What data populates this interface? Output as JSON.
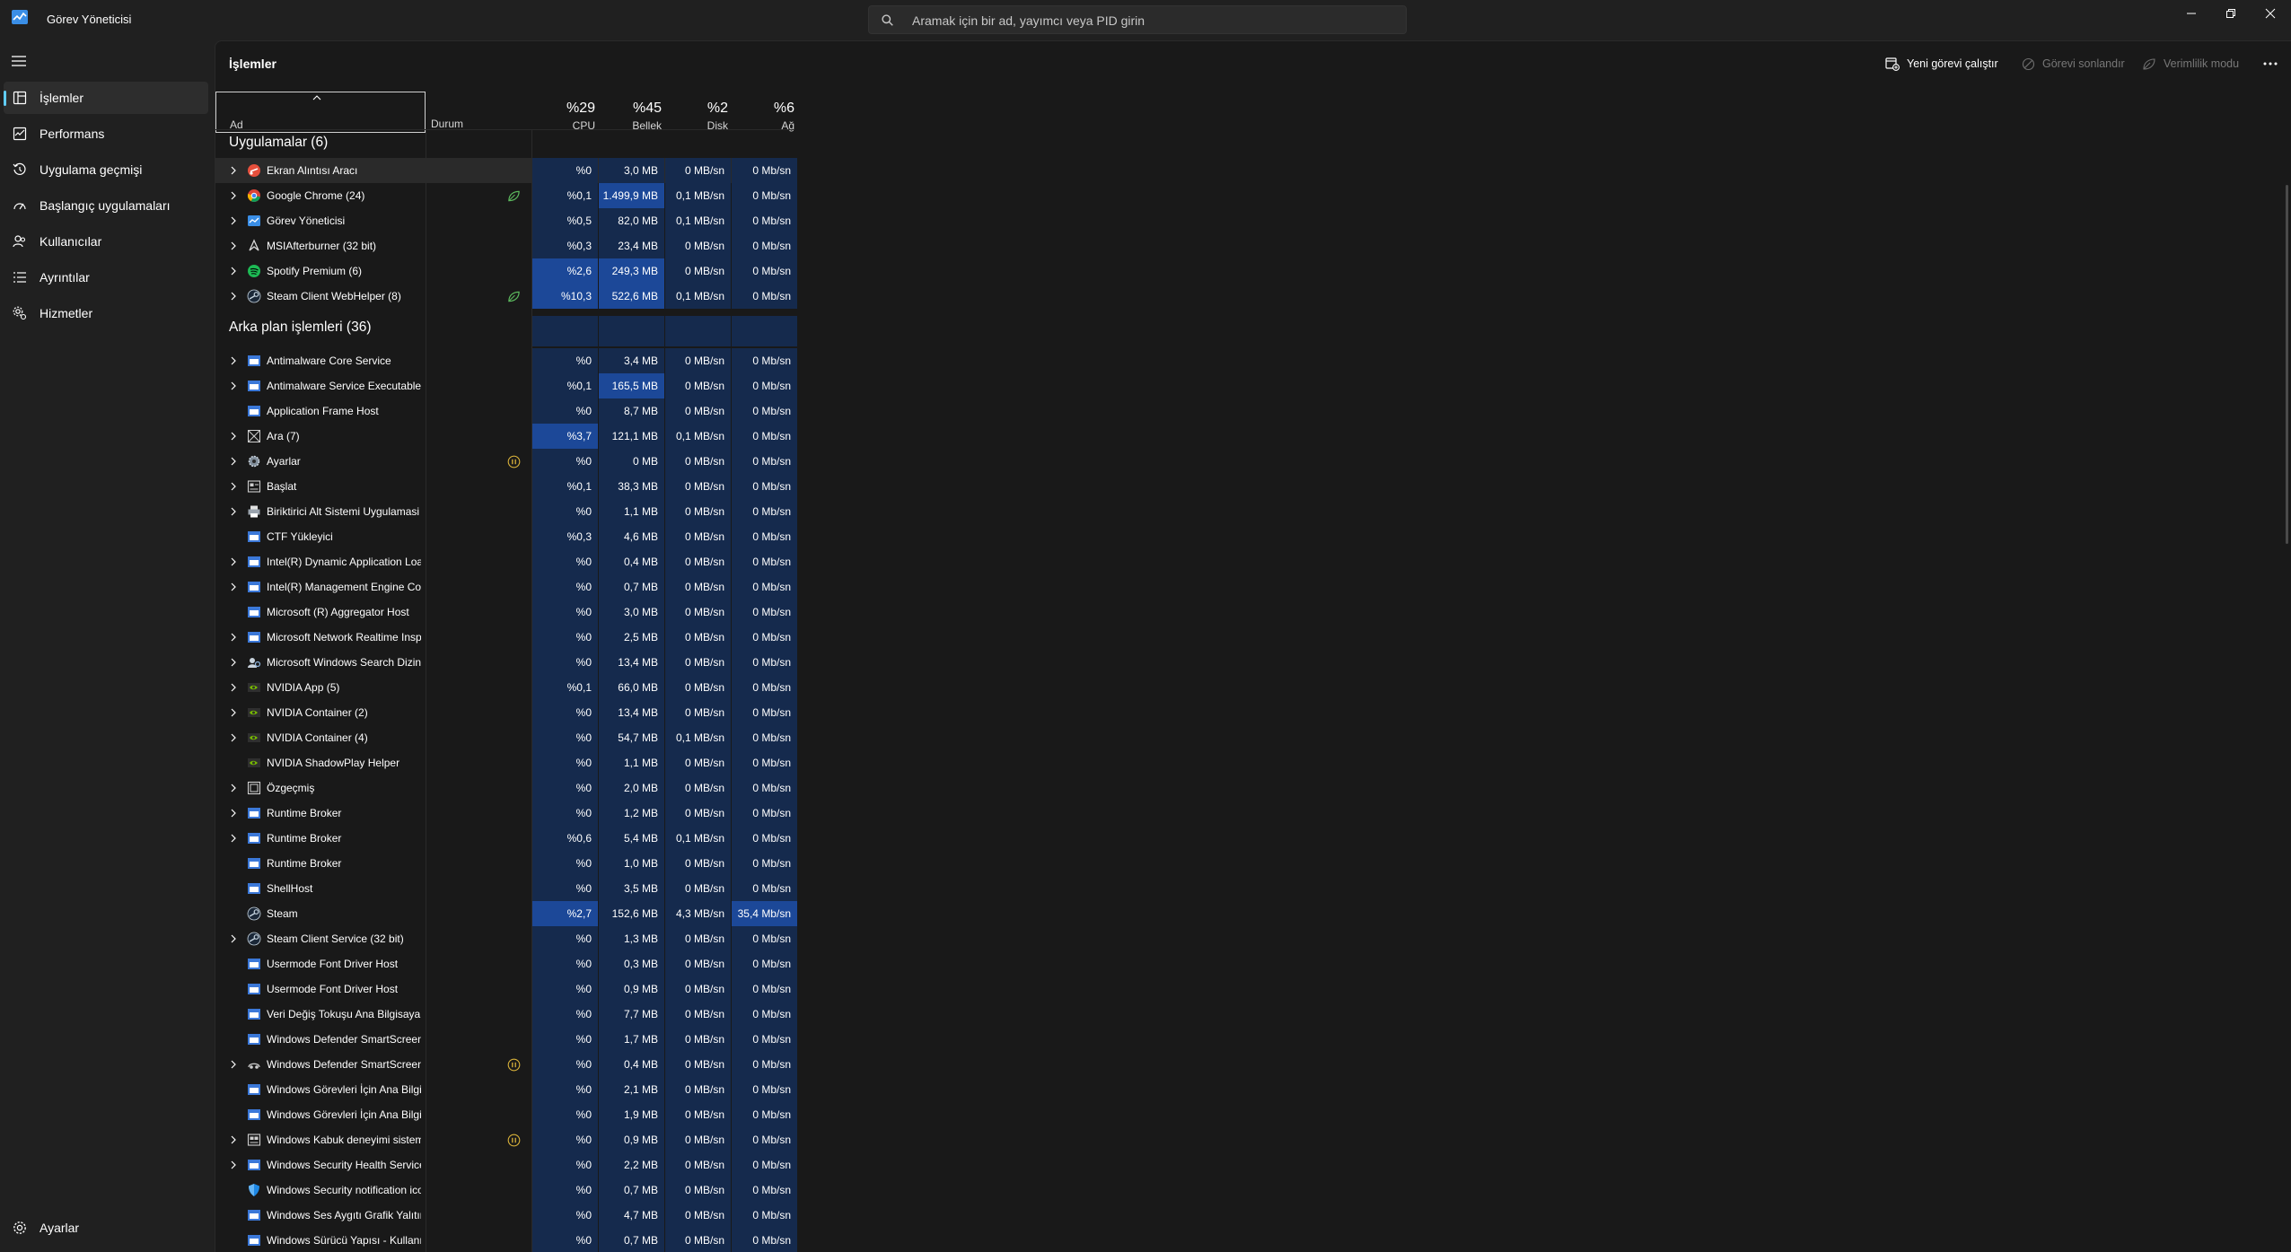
{
  "titlebar": {
    "app_title": "Görev Yöneticisi",
    "search_placeholder": "Aramak için bir ad, yayımcı veya PID girin"
  },
  "sidebar": {
    "items": [
      {
        "label": "İşlemler",
        "icon": "processes-icon",
        "active": true
      },
      {
        "label": "Performans",
        "icon": "performance-icon"
      },
      {
        "label": "Uygulama geçmişi",
        "icon": "app-history-icon"
      },
      {
        "label": "Başlangıç uygulamaları",
        "icon": "startup-apps-icon"
      },
      {
        "label": "Kullanıcılar",
        "icon": "users-icon"
      },
      {
        "label": "Ayrıntılar",
        "icon": "details-icon"
      },
      {
        "label": "Hizmetler",
        "icon": "services-icon"
      }
    ],
    "settings_label": "Ayarlar"
  },
  "main": {
    "title": "İşlemler",
    "toolbar": {
      "run_new_task": "Yeni görevi çalıştır",
      "end_task": "Görevi sonlandır",
      "efficiency_mode": "Verimlilik modu"
    },
    "columns": {
      "name": "Ad",
      "status": "Durum",
      "cpu_pct": "%29",
      "cpu": "CPU",
      "mem_pct": "%45",
      "mem": "Bellek",
      "disk_pct": "%2",
      "disk": "Disk",
      "net_pct": "%6",
      "net": "Ağ"
    },
    "groups": [
      {
        "title": "Uygulamalar (6)",
        "rows": [
          {
            "name": "Ekran Alıntısı Aracı",
            "icon": "snipping-tool-icon",
            "expand": true,
            "status": "",
            "cpu": "%0",
            "mem": "3,0 MB",
            "disk": "0 MB/sn",
            "net": "0 Mb/sn",
            "hl": []
          },
          {
            "name": "Google Chrome (24)",
            "icon": "chrome-icon",
            "expand": true,
            "status": "efficiency",
            "cpu": "%0,1",
            "mem": "1.499,9 MB",
            "disk": "0,1 MB/sn",
            "net": "0 Mb/sn",
            "hl": [
              "mem"
            ]
          },
          {
            "name": "Görev Yöneticisi",
            "icon": "task-manager-icon",
            "expand": true,
            "status": "",
            "cpu": "%0,5",
            "mem": "82,0 MB",
            "disk": "0,1 MB/sn",
            "net": "0 Mb/sn",
            "hl": []
          },
          {
            "name": "MSIAfterburner (32 bit)",
            "icon": "afterburner-icon",
            "expand": true,
            "status": "",
            "cpu": "%0,3",
            "mem": "23,4 MB",
            "disk": "0 MB/sn",
            "net": "0 Mb/sn",
            "hl": []
          },
          {
            "name": "Spotify Premium (6)",
            "icon": "spotify-icon",
            "expand": true,
            "status": "",
            "cpu": "%2,6",
            "mem": "249,3 MB",
            "disk": "0 MB/sn",
            "net": "0 Mb/sn",
            "hl": [
              "cpu",
              "mem"
            ]
          },
          {
            "name": "Steam Client WebHelper (8)",
            "icon": "steam-icon",
            "expand": true,
            "status": "efficiency",
            "cpu": "%10,3",
            "mem": "522,6 MB",
            "disk": "0,1 MB/sn",
            "net": "0 Mb/sn",
            "hl": [
              "cpu",
              "mem"
            ]
          }
        ]
      },
      {
        "title": "Arka plan işlemleri (36)",
        "rows": [
          {
            "name": "Antimalware Core Service",
            "icon": "window-app-icon",
            "expand": true,
            "status": "",
            "cpu": "%0",
            "mem": "3,4 MB",
            "disk": "0 MB/sn",
            "net": "0 Mb/sn",
            "hl": []
          },
          {
            "name": "Antimalware Service Executable",
            "icon": "window-app-icon",
            "expand": true,
            "status": "",
            "cpu": "%0,1",
            "mem": "165,5 MB",
            "disk": "0 MB/sn",
            "net": "0 Mb/sn",
            "hl": [
              "mem"
            ]
          },
          {
            "name": "Application Frame Host",
            "icon": "window-app-icon",
            "expand": false,
            "status": "",
            "cpu": "%0",
            "mem": "8,7 MB",
            "disk": "0 MB/sn",
            "net": "0 Mb/sn",
            "hl": []
          },
          {
            "name": "Ara (7)",
            "icon": "search-app-icon",
            "expand": true,
            "status": "",
            "cpu": "%3,7",
            "mem": "121,1 MB",
            "disk": "0,1 MB/sn",
            "net": "0 Mb/sn",
            "hl": [
              "cpu"
            ]
          },
          {
            "name": "Ayarlar",
            "icon": "settings-app-icon",
            "expand": true,
            "status": "paused",
            "cpu": "%0",
            "mem": "0 MB",
            "disk": "0 MB/sn",
            "net": "0 Mb/sn",
            "hl": []
          },
          {
            "name": "Başlat",
            "icon": "start-app-icon",
            "expand": true,
            "status": "",
            "cpu": "%0,1",
            "mem": "38,3 MB",
            "disk": "0 MB/sn",
            "net": "0 Mb/sn",
            "hl": []
          },
          {
            "name": "Biriktirici Alt Sistemi Uygulamasi",
            "icon": "printer-icon",
            "expand": true,
            "status": "",
            "cpu": "%0",
            "mem": "1,1 MB",
            "disk": "0 MB/sn",
            "net": "0 Mb/sn",
            "hl": []
          },
          {
            "name": "CTF Yükleyici",
            "icon": "window-app-icon",
            "expand": false,
            "status": "",
            "cpu": "%0,3",
            "mem": "4,6 MB",
            "disk": "0 MB/sn",
            "net": "0 Mb/sn",
            "hl": []
          },
          {
            "name": "Intel(R) Dynamic Application Loader",
            "icon": "window-app-icon",
            "expand": true,
            "status": "",
            "cpu": "%0",
            "mem": "0,4 MB",
            "disk": "0 MB/sn",
            "net": "0 Mb/sn",
            "hl": []
          },
          {
            "name": "Intel(R) Management Engine Components",
            "icon": "window-app-icon",
            "expand": true,
            "status": "",
            "cpu": "%0",
            "mem": "0,7 MB",
            "disk": "0 MB/sn",
            "net": "0 Mb/sn",
            "hl": []
          },
          {
            "name": "Microsoft (R) Aggregator Host",
            "icon": "window-app-icon",
            "expand": false,
            "status": "",
            "cpu": "%0",
            "mem": "3,0 MB",
            "disk": "0 MB/sn",
            "net": "0 Mb/sn",
            "hl": []
          },
          {
            "name": "Microsoft Network Realtime Inspection",
            "icon": "window-app-icon",
            "expand": true,
            "status": "",
            "cpu": "%0",
            "mem": "2,5 MB",
            "disk": "0 MB/sn",
            "net": "0 Mb/sn",
            "hl": []
          },
          {
            "name": "Microsoft Windows Search Dizin Oluşturucu",
            "icon": "search-indexer-icon",
            "expand": true,
            "status": "",
            "cpu": "%0",
            "mem": "13,4 MB",
            "disk": "0 MB/sn",
            "net": "0 Mb/sn",
            "hl": []
          },
          {
            "name": "NVIDIA App (5)",
            "icon": "nvidia-icon",
            "expand": true,
            "status": "",
            "cpu": "%0,1",
            "mem": "66,0 MB",
            "disk": "0 MB/sn",
            "net": "0 Mb/sn",
            "hl": []
          },
          {
            "name": "NVIDIA Container (2)",
            "icon": "nvidia-icon",
            "expand": true,
            "status": "",
            "cpu": "%0",
            "mem": "13,4 MB",
            "disk": "0 MB/sn",
            "net": "0 Mb/sn",
            "hl": []
          },
          {
            "name": "NVIDIA Container (4)",
            "icon": "nvidia-icon",
            "expand": true,
            "status": "",
            "cpu": "%0",
            "mem": "54,7 MB",
            "disk": "0,1 MB/sn",
            "net": "0 Mb/sn",
            "hl": []
          },
          {
            "name": "NVIDIA ShadowPlay Helper",
            "icon": "nvidia-icon",
            "expand": false,
            "status": "",
            "cpu": "%0",
            "mem": "1,1 MB",
            "disk": "0 MB/sn",
            "net": "0 Mb/sn",
            "hl": []
          },
          {
            "name": "Özgeçmiş",
            "icon": "resume-icon",
            "expand": true,
            "status": "",
            "cpu": "%0",
            "mem": "2,0 MB",
            "disk": "0 MB/sn",
            "net": "0 Mb/sn",
            "hl": []
          },
          {
            "name": "Runtime Broker",
            "icon": "window-app-icon",
            "expand": true,
            "status": "",
            "cpu": "%0",
            "mem": "1,2 MB",
            "disk": "0 MB/sn",
            "net": "0 Mb/sn",
            "hl": []
          },
          {
            "name": "Runtime Broker",
            "icon": "window-app-icon",
            "expand": true,
            "status": "",
            "cpu": "%0,6",
            "mem": "5,4 MB",
            "disk": "0,1 MB/sn",
            "net": "0 Mb/sn",
            "hl": []
          },
          {
            "name": "Runtime Broker",
            "icon": "window-app-icon",
            "expand": false,
            "status": "",
            "cpu": "%0",
            "mem": "1,0 MB",
            "disk": "0 MB/sn",
            "net": "0 Mb/sn",
            "hl": []
          },
          {
            "name": "ShellHost",
            "icon": "window-app-icon",
            "expand": false,
            "status": "",
            "cpu": "%0",
            "mem": "3,5 MB",
            "disk": "0 MB/sn",
            "net": "0 Mb/sn",
            "hl": []
          },
          {
            "name": "Steam",
            "icon": "steam-icon",
            "expand": false,
            "status": "",
            "cpu": "%2,7",
            "mem": "152,6 MB",
            "disk": "4,3 MB/sn",
            "net": "35,4 Mb/sn",
            "hl": [
              "cpu",
              "net"
            ]
          },
          {
            "name": "Steam Client Service (32 bit)",
            "icon": "steam-icon",
            "expand": true,
            "status": "",
            "cpu": "%0",
            "mem": "1,3 MB",
            "disk": "0 MB/sn",
            "net": "0 Mb/sn",
            "hl": []
          },
          {
            "name": "Usermode Font Driver Host",
            "icon": "window-app-icon",
            "expand": false,
            "status": "",
            "cpu": "%0",
            "mem": "0,3 MB",
            "disk": "0 MB/sn",
            "net": "0 Mb/sn",
            "hl": []
          },
          {
            "name": "Usermode Font Driver Host",
            "icon": "window-app-icon",
            "expand": false,
            "status": "",
            "cpu": "%0",
            "mem": "0,9 MB",
            "disk": "0 MB/sn",
            "net": "0 Mb/sn",
            "hl": []
          },
          {
            "name": "Veri Değiş Tokuşu Ana Bilgisayarı",
            "icon": "window-app-icon",
            "expand": false,
            "status": "",
            "cpu": "%0",
            "mem": "7,7 MB",
            "disk": "0 MB/sn",
            "net": "0 Mb/sn",
            "hl": []
          },
          {
            "name": "Windows Defender SmartScreen",
            "icon": "window-app-icon",
            "expand": false,
            "status": "",
            "cpu": "%0",
            "mem": "1,7 MB",
            "disk": "0 MB/sn",
            "net": "0 Mb/sn",
            "hl": []
          },
          {
            "name": "Windows Defender SmartScreen",
            "icon": "smartscreen-icon",
            "expand": true,
            "status": "paused",
            "cpu": "%0",
            "mem": "0,4 MB",
            "disk": "0 MB/sn",
            "net": "0 Mb/sn",
            "hl": []
          },
          {
            "name": "Windows Görevleri İçin Ana Bilgisayar",
            "icon": "window-app-icon",
            "expand": false,
            "status": "",
            "cpu": "%0",
            "mem": "2,1 MB",
            "disk": "0 MB/sn",
            "net": "0 Mb/sn",
            "hl": []
          },
          {
            "name": "Windows Görevleri İçin Ana Bilgisayar",
            "icon": "window-app-icon",
            "expand": false,
            "status": "",
            "cpu": "%0",
            "mem": "1,9 MB",
            "disk": "0 MB/sn",
            "net": "0 Mb/sn",
            "hl": []
          },
          {
            "name": "Windows Kabuk deneyimi sistemi",
            "icon": "shell-experience-icon",
            "expand": true,
            "status": "paused",
            "cpu": "%0",
            "mem": "0,9 MB",
            "disk": "0 MB/sn",
            "net": "0 Mb/sn",
            "hl": []
          },
          {
            "name": "Windows Security Health Service",
            "icon": "window-app-icon",
            "expand": true,
            "status": "",
            "cpu": "%0",
            "mem": "2,2 MB",
            "disk": "0 MB/sn",
            "net": "0 Mb/sn",
            "hl": []
          },
          {
            "name": "Windows Security notification icon",
            "icon": "shield-icon",
            "expand": false,
            "status": "",
            "cpu": "%0",
            "mem": "0,7 MB",
            "disk": "0 MB/sn",
            "net": "0 Mb/sn",
            "hl": []
          },
          {
            "name": "Windows Ses Aygıtı Grafik Yalıtımı",
            "icon": "window-app-icon",
            "expand": false,
            "status": "",
            "cpu": "%0",
            "mem": "4,7 MB",
            "disk": "0 MB/sn",
            "net": "0 Mb/sn",
            "hl": []
          },
          {
            "name": "Windows Sürücü Yapısı - Kullanıcı",
            "icon": "window-app-icon",
            "expand": false,
            "status": "",
            "cpu": "%0",
            "mem": "0,7 MB",
            "disk": "0 MB/sn",
            "net": "0 Mb/sn",
            "hl": []
          }
        ]
      }
    ]
  },
  "colors": {
    "accent": "#60cdff",
    "cell_base": "#152a4d",
    "cell_highlight": "#1c4898",
    "efficiency_leaf": "#5bb85d",
    "paused": "#d9b23a"
  }
}
